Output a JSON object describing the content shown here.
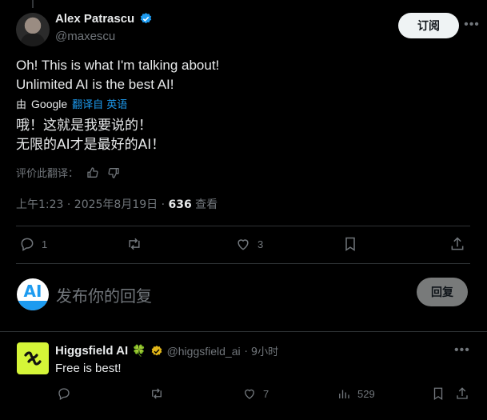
{
  "post": {
    "author": {
      "name": "Alex Patrascu",
      "handle": "@maxescu"
    },
    "subscribe_label": "订阅",
    "text_line1": "Oh! This is what I'm talking about!",
    "text_line2": "Unlimited AI is the best AI!",
    "translate": {
      "by": "由",
      "google": "Google",
      "translated_from": "翻译自 英语"
    },
    "translated_line1": "哦！这就是我要说的！",
    "translated_line2": "无限的AI才是最好的AI！",
    "rate_translation": "评价此翻译：",
    "meta": {
      "time_date": "上午1:23 · 2025年8月19日 · ",
      "views": "636",
      "views_label": " 查看"
    },
    "actions": {
      "replies": "1",
      "likes": "3"
    }
  },
  "reply_composer": {
    "placeholder": "发布你的回复",
    "button": "回复"
  },
  "reply": {
    "author": {
      "name": "Higgsfield AI",
      "emoji": "🍀",
      "handle": "@higgsfield_ai",
      "time": "· 9小时"
    },
    "text": "Free is best!",
    "actions": {
      "likes": "7",
      "views": "529"
    }
  },
  "colors": {
    "accent": "#1d9bf0",
    "verified_gold": "#e2b719",
    "muted": "#71767b"
  },
  "icons": [
    "verified-icon",
    "more-icon",
    "thumbs-up-icon",
    "thumbs-down-icon",
    "reply-icon",
    "retweet-icon",
    "like-icon",
    "bookmark-icon",
    "share-icon",
    "views-icon"
  ]
}
